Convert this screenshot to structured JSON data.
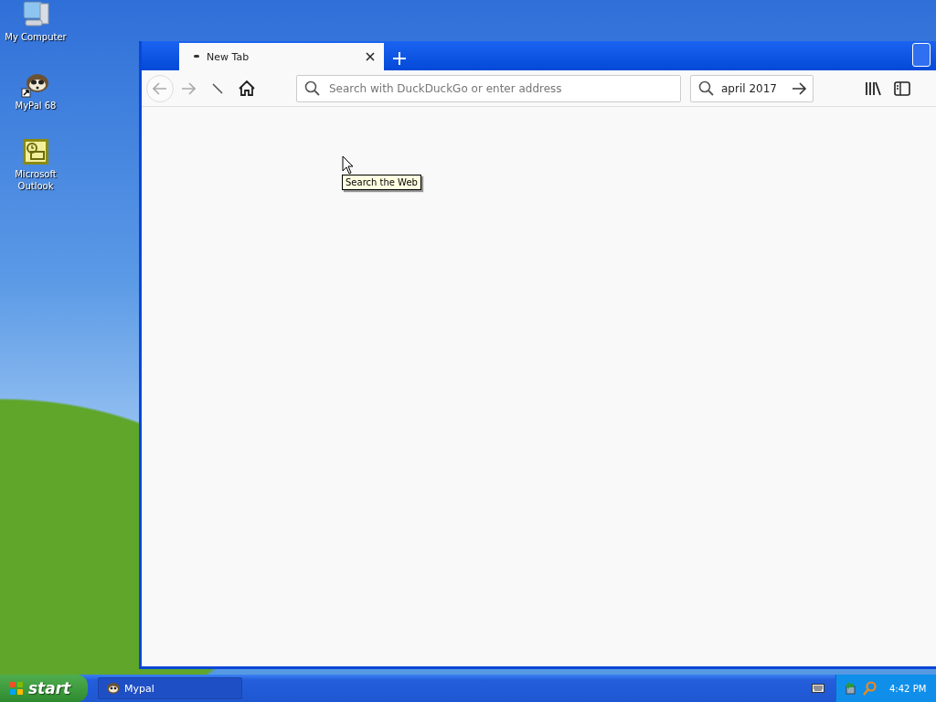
{
  "desktop_icons": [
    {
      "label": "My Computer"
    },
    {
      "label": "MyPal 68"
    },
    {
      "label": "Microsoft Outlook"
    }
  ],
  "browser": {
    "tabs": [
      {
        "label": "New Tab",
        "selected": true
      }
    ],
    "address_bar": {
      "placeholder": "Search with DuckDuckGo or enter address"
    },
    "search_bar": {
      "value": "april 2017"
    },
    "tooltip": "Search the Web"
  },
  "taskbar": {
    "start_label": "start",
    "tasks": [
      {
        "label": "Mypal"
      }
    ],
    "clock": "4:42 PM"
  }
}
